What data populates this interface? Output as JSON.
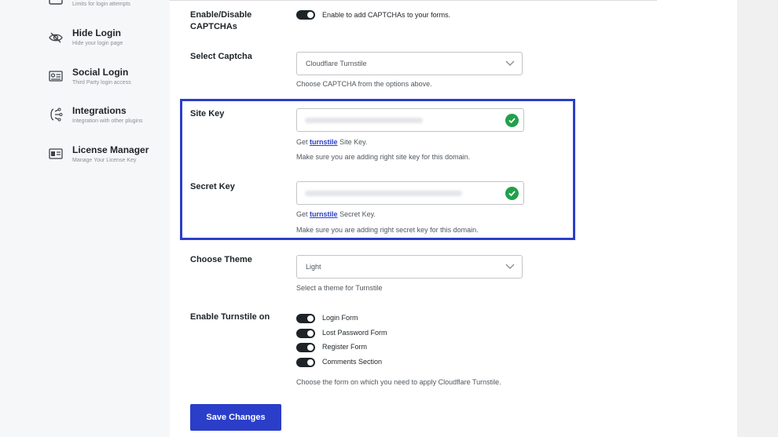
{
  "sidebar": {
    "partial_sub": "Limits for login attempts",
    "items": [
      {
        "title": "Hide Login",
        "sub": "Hide your login page",
        "icon": "eye-slash-icon"
      },
      {
        "title": "Social Login",
        "sub": "Third Party login access",
        "icon": "id-card-icon"
      },
      {
        "title": "Integrations",
        "sub": "Integration with other plugins",
        "icon": "plug-icon"
      },
      {
        "title": "License Manager",
        "sub": "Manage Your License Key",
        "icon": "license-card-icon"
      }
    ]
  },
  "captcha": {
    "label": "Enable/Disable CAPTCHAs",
    "toggle_on": true,
    "toggle_text": "Enable to add CAPTCHAs to your forms."
  },
  "select_captcha": {
    "label": "Select Captcha",
    "value": "Cloudflare Turnstile",
    "help": "Choose CAPTCHA from the options above."
  },
  "site_key": {
    "label": "Site Key",
    "help_prefix": "Get",
    "help_link": "turnstile",
    "help_suffix": "Site Key.",
    "note": "Make sure you are adding right site key for this domain.",
    "status_icon": "check-circle-icon"
  },
  "secret_key": {
    "label": "Secret Key",
    "help_prefix": "Get",
    "help_link": "turnstile",
    "help_suffix": "Secret Key.",
    "note": "Make sure you are adding right secret key for this domain.",
    "status_icon": "check-circle-icon"
  },
  "theme": {
    "label": "Choose Theme",
    "value": "Light",
    "help": "Select a theme for Turnstile"
  },
  "turnstile_on": {
    "label": "Enable Turnstile on",
    "options": [
      {
        "label": "Login Form",
        "on": true
      },
      {
        "label": "Lost Password Form",
        "on": true
      },
      {
        "label": "Register Form",
        "on": true
      },
      {
        "label": "Comments Section",
        "on": true
      }
    ],
    "help": "Choose the form on which you need to apply Cloudflare Turnstile."
  },
  "save_label": "Save Changes",
  "colors": {
    "accent": "#2b3ec9",
    "success": "#22a04b",
    "toggle": "#1d2327"
  }
}
